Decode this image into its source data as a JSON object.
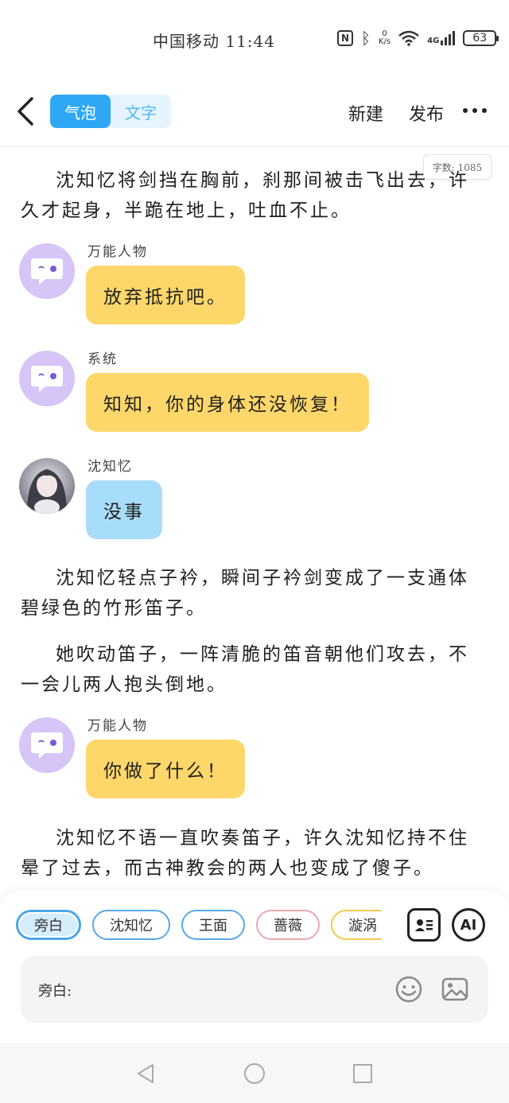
{
  "status_bar": {
    "carrier_time": "中国移动 11:44",
    "speed_value": "0",
    "speed_unit": "K/s",
    "network": "4G",
    "battery": "63"
  },
  "header": {
    "tabs": [
      {
        "label": "气泡",
        "active": true
      },
      {
        "label": "文字",
        "active": false
      }
    ],
    "new_label": "新建",
    "publish_label": "发布"
  },
  "word_count": "字数: 1085",
  "content": {
    "narration_1": "沈知忆将剑挡在胸前，刹那间被击飞出去，许久才起身，半跪在地上，吐血不止。",
    "msg_1": {
      "speaker": "万能人物",
      "text": "放弃抵抗吧。"
    },
    "msg_2": {
      "speaker": "系统",
      "text": "知知，你的身体还没恢复！"
    },
    "msg_3": {
      "speaker": "沈知忆",
      "text": "没事"
    },
    "narration_2": "沈知忆轻点子衿，瞬间子衿剑变成了一支通体碧绿色的竹形笛子。",
    "narration_3": "她吹动笛子，一阵清脆的笛音朝他们攻去，不一会儿两人抱头倒地。",
    "msg_4": {
      "speaker": "万能人物",
      "text": "你做了什么！"
    },
    "narration_4": "沈知忆不语一直吹奏笛子，许久沈知忆持不住晕了过去，而古神教会的两人也变成了傻子。"
  },
  "bottom": {
    "chips": [
      "旁白",
      "沈知忆",
      "王面",
      "蔷薇",
      "漩涡"
    ],
    "ai_label": "AI",
    "input_label": "旁白:",
    "input_value": ""
  },
  "colors": {
    "accent_blue": "#2ea8f5",
    "bubble_yellow": "#fed76a",
    "bubble_blue": "#a8dcfb",
    "avatar_purple": "#d6c6f7"
  }
}
